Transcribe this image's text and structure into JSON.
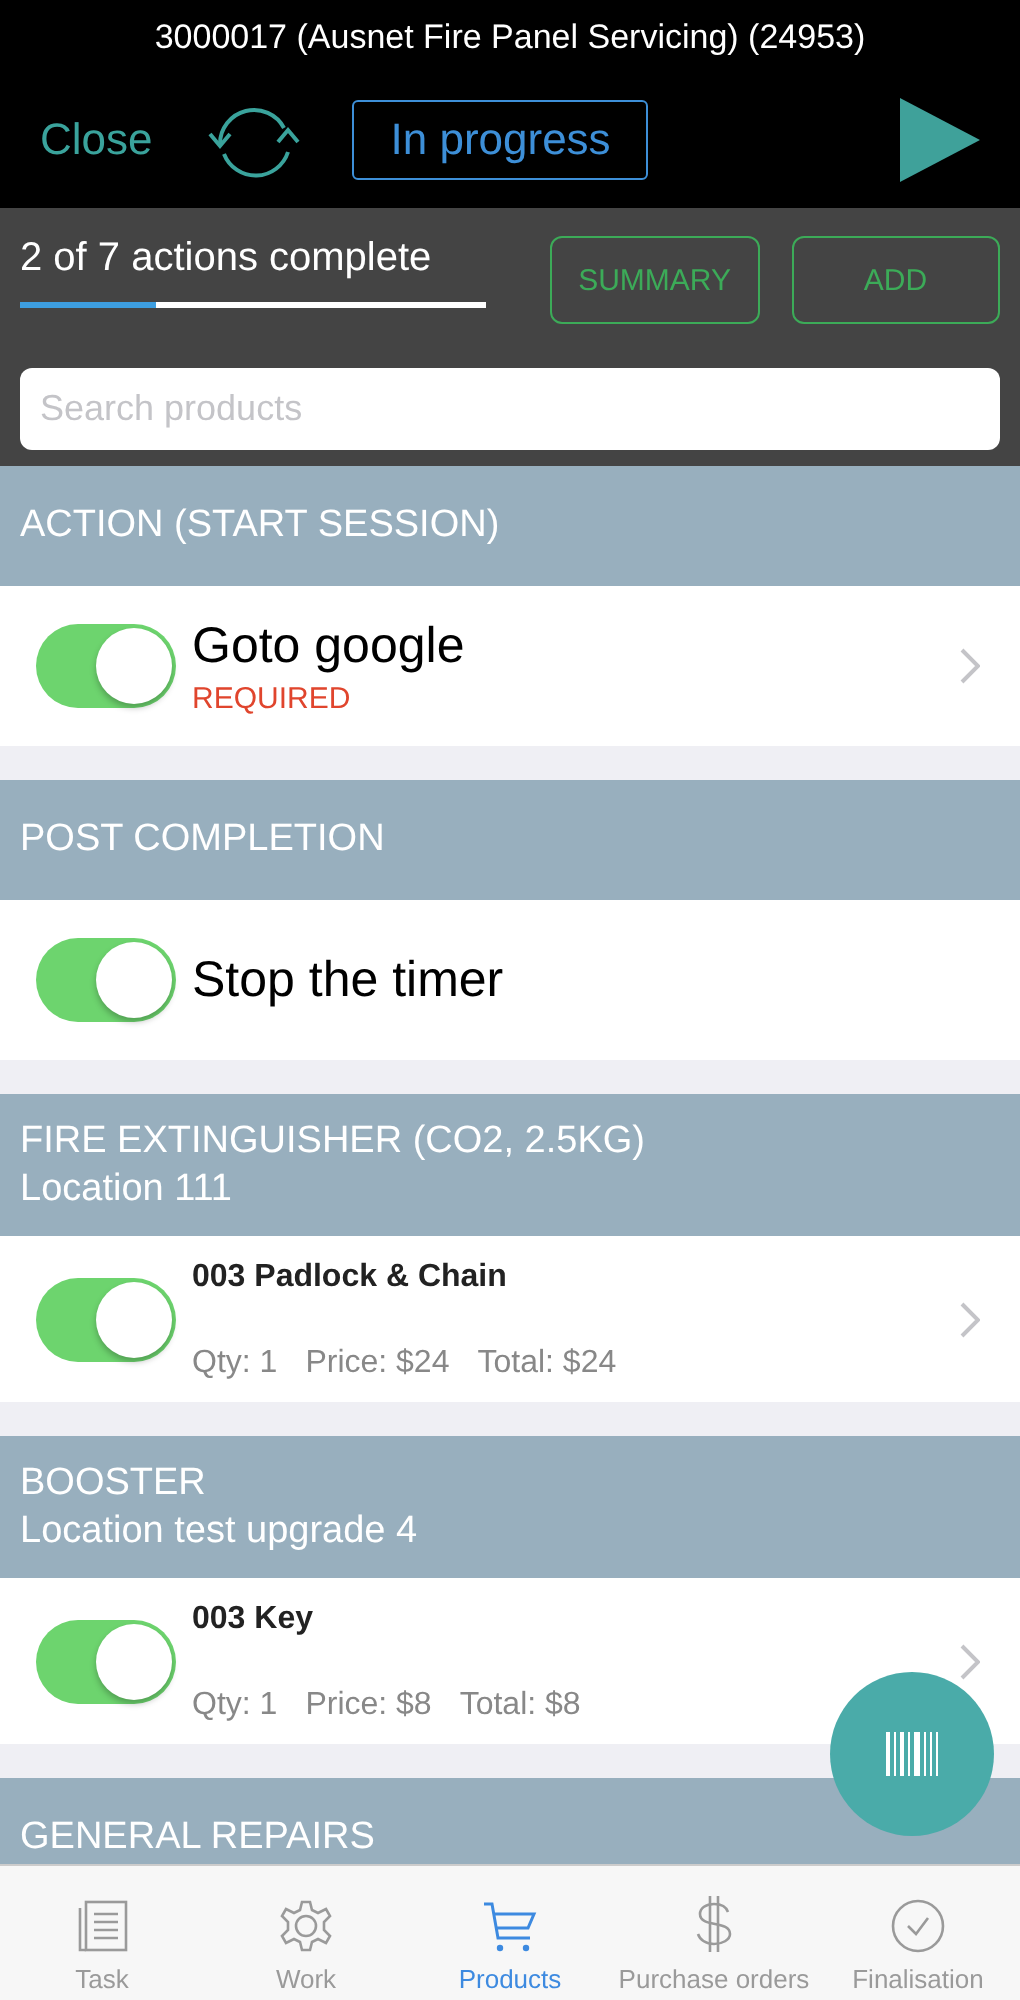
{
  "window": {
    "title": "3000017 (Ausnet Fire Panel Servicing) (24953)"
  },
  "toolbar": {
    "close": "Close",
    "status": "In progress"
  },
  "progress": {
    "label": "2 of 7 actions complete",
    "level": 0.29
  },
  "buttons": [
    "SUMMARY",
    "ADD"
  ],
  "search": {
    "placeholder": "Search products"
  },
  "sections": [
    {
      "title": "ACTION (START SESSION)",
      "items": [
        {
          "kind": "action",
          "name": "Goto google",
          "note": "REQUIRED",
          "on": true,
          "chevron": true
        }
      ]
    },
    {
      "title": "POST COMPLETION",
      "items": [
        {
          "kind": "action",
          "name": "Stop the timer",
          "on": true,
          "chevron": false
        }
      ]
    },
    {
      "title": "FIRE EXTINGUISHER  (CO2, 2.5KG)",
      "subtitle": "Location 111",
      "items": [
        {
          "kind": "product",
          "name": "003 Padlock & Chain",
          "qty": "Qty: 1",
          "price": "Price: $24",
          "total": "Total: $24",
          "on": true,
          "chevron": true
        }
      ]
    },
    {
      "title": "BOOSTER",
      "subtitle": "Location test upgrade 4",
      "items": [
        {
          "kind": "product",
          "name": "003 Key",
          "qty": "Qty: 1",
          "price": "Price: $8",
          "total": "Total: $8",
          "on": true,
          "chevron": true
        }
      ]
    },
    {
      "title": "GENERAL REPAIRS"
    }
  ],
  "tabs": [
    {
      "label": "Task",
      "selected": false
    },
    {
      "label": "Work",
      "selected": false
    },
    {
      "label": "Products",
      "selected": true
    },
    {
      "label": "Purchase orders",
      "selected": false
    },
    {
      "label": "Finalisation",
      "selected": false
    }
  ]
}
